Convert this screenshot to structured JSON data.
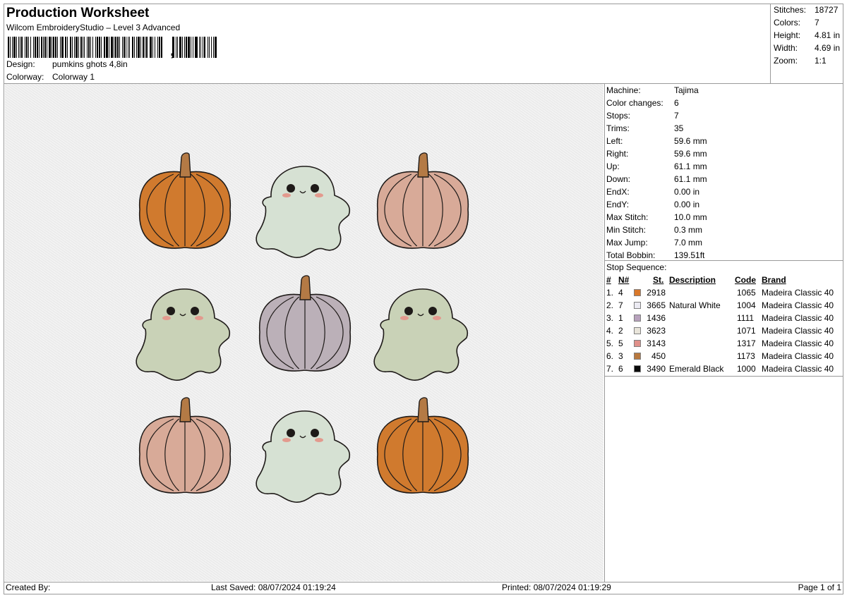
{
  "header": {
    "title": "Production Worksheet",
    "software": "Wilcom EmbroideryStudio – Level 3 Advanced",
    "barcode_suffix": ",",
    "design_label": "Design:",
    "design_value": "pumkins ghots 4,8in",
    "colorway_label": "Colorway:",
    "colorway_value": "Colorway 1"
  },
  "summary": {
    "stitches_label": "Stitches:",
    "stitches_value": "18727",
    "colors_label": "Colors:",
    "colors_value": "7",
    "height_label": "Height:",
    "height_value": "4.81 in",
    "width_label": "Width:",
    "width_value": "4.69 in",
    "zoom_label": "Zoom:",
    "zoom_value": "1:1"
  },
  "machine_info": [
    {
      "label": "Machine:",
      "value": "Tajima"
    },
    {
      "label": "Color changes:",
      "value": "6"
    },
    {
      "label": "Stops:",
      "value": "7"
    },
    {
      "label": "Trims:",
      "value": "35"
    },
    {
      "label": "Left:",
      "value": "59.6 mm"
    },
    {
      "label": "Right:",
      "value": "59.6 mm"
    },
    {
      "label": "Up:",
      "value": "61.1 mm"
    },
    {
      "label": "Down:",
      "value": "61.1 mm"
    },
    {
      "label": "EndX:",
      "value": "0.00 in"
    },
    {
      "label": "EndY:",
      "value": "0.00 in"
    },
    {
      "label": "Max Stitch:",
      "value": "10.0 mm"
    },
    {
      "label": "Min Stitch:",
      "value": "0.3 mm"
    },
    {
      "label": "Max Jump:",
      "value": "7.0 mm"
    },
    {
      "label": "Total Bobbin:",
      "value": "139.51ft"
    }
  ],
  "stop_sequence": {
    "title": "Stop Sequence:",
    "headers": {
      "num": "#",
      "n": "N#",
      "st": "St.",
      "desc": "Description",
      "code": "Code",
      "brand": "Brand"
    },
    "rows": [
      {
        "num": "1.",
        "n": "4",
        "color": "#d9782a",
        "st": "2918",
        "desc": "",
        "code": "1065",
        "brand": "Madeira Classic 40"
      },
      {
        "num": "2.",
        "n": "7",
        "color": "#ecebf3",
        "st": "3665",
        "desc": "Natural White",
        "code": "1004",
        "brand": "Madeira Classic 40"
      },
      {
        "num": "3.",
        "n": "1",
        "color": "#b8a2bd",
        "st": "1436",
        "desc": "",
        "code": "1111",
        "brand": "Madeira Classic 40"
      },
      {
        "num": "4.",
        "n": "2",
        "color": "#e9e5da",
        "st": "3623",
        "desc": "",
        "code": "1071",
        "brand": "Madeira Classic 40"
      },
      {
        "num": "5.",
        "n": "5",
        "color": "#e0908a",
        "st": "3143",
        "desc": "",
        "code": "1317",
        "brand": "Madeira Classic 40"
      },
      {
        "num": "6.",
        "n": "3",
        "color": "#b8783e",
        "st": "450",
        "desc": "",
        "code": "1173",
        "brand": "Madeira Classic 40"
      },
      {
        "num": "7.",
        "n": "6",
        "color": "#0a0a0a",
        "st": "3490",
        "desc": "Emerald Black",
        "code": "1000",
        "brand": "Madeira Classic 40"
      }
    ]
  },
  "design_preview": {
    "items": [
      "pumpkin-orange",
      "ghost-mint",
      "pumpkin-pink",
      "ghost-sage",
      "pumpkin-lilac",
      "ghost-sage",
      "pumpkin-pink",
      "ghost-mint",
      "pumpkin-orange"
    ],
    "colors": {
      "pumpkin_orange": "#d07a2e",
      "pumpkin_pink": "#d8aa98",
      "pumpkin_lilac": "#bbb0b8",
      "ghost_mint": "#d6e1d3",
      "ghost_sage": "#c9d2b7",
      "stem": "#b47a45",
      "outline": "#1e1a18",
      "cheek": "#e39a8e"
    }
  },
  "footer": {
    "created_by": "Created By:",
    "last_saved": "Last Saved: 08/07/2024 01:19:24",
    "printed": "Printed: 08/07/2024 01:19:29",
    "page": "Page 1 of 1"
  }
}
